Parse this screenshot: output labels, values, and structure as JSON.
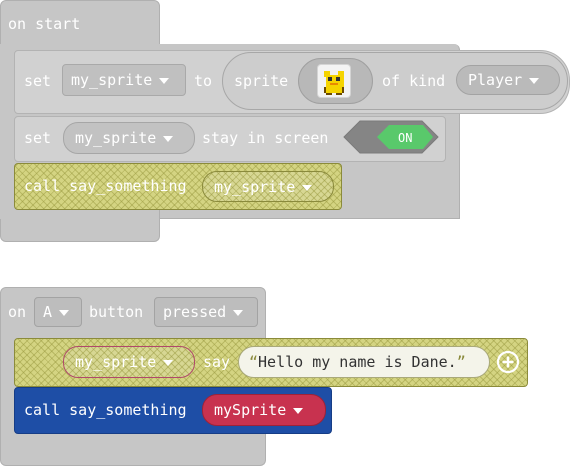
{
  "workspace": {
    "on_start": {
      "label": "on start",
      "set_stmt": {
        "set_label": "set",
        "variable": "my_sprite",
        "to_label": "to",
        "sprite_label": "sprite",
        "sprite_image": "yellow-duck-sprite-icon",
        "of_kind_label": "of kind",
        "kind": "Player"
      },
      "stay_stmt": {
        "set_label": "set",
        "variable": "my_sprite",
        "label": "stay in screen",
        "toggle": "ON"
      },
      "call_stmt": {
        "label": "call say_something",
        "arg": "my_sprite"
      }
    },
    "on_button": {
      "on_label": "on",
      "button": "A",
      "button_label": "button",
      "event": "pressed",
      "say_stmt": {
        "variable": "my_sprite",
        "say_label": "say",
        "text": "Hello my name is Dane."
      },
      "call_stmt": {
        "label": "call say_something",
        "arg": "mySprite"
      }
    }
  },
  "colors": {
    "event_block": "#c6c6c6",
    "statement_grey": "#d1d1d1",
    "disabled_hatch": "#d4d482",
    "call_active": "#1e4ea6",
    "arg_red": "#c8324f",
    "toggle_on": "#59c96b"
  }
}
